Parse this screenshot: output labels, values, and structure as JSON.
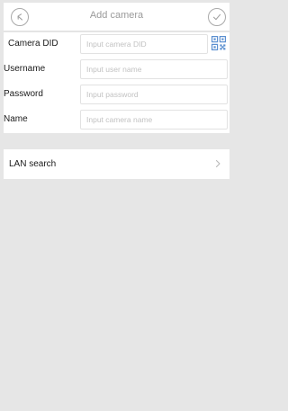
{
  "header": {
    "title": "Add camera",
    "back_icon": "back-arrow-icon",
    "confirm_icon": "checkmark-icon"
  },
  "form": {
    "camera_did": {
      "label": "Camera DID",
      "placeholder": "Input camera DID",
      "value": ""
    },
    "username": {
      "label": "Username",
      "placeholder": "Input user name",
      "value": ""
    },
    "password": {
      "label": "Password",
      "placeholder": "Input password",
      "value": ""
    },
    "name": {
      "label": "Name",
      "placeholder": "Input camera name",
      "value": ""
    },
    "qr_icon": "qr-code-icon"
  },
  "lan": {
    "label": "LAN search",
    "chevron_icon": "chevron-right-icon"
  },
  "colors": {
    "accent": "#5a8fd0",
    "background": "#e6e6e6",
    "panel": "#ffffff"
  }
}
